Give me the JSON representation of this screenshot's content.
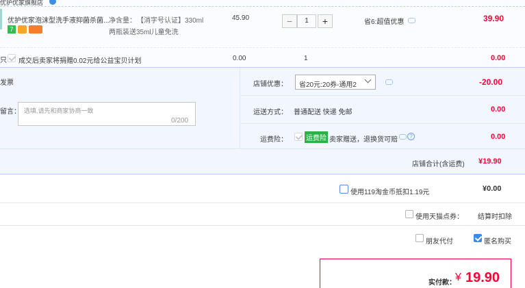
{
  "top": {
    "shop_name_fragment": "优护优家旗舰店"
  },
  "item": {
    "title": "优护优家泡沫型洗手液抑菌杀菌...",
    "spec_label": "净含量：",
    "spec_value": "【消字号认证】330ml",
    "spec_line2": "两瓶装送35ml儿童免洗",
    "unit_price": "45.90",
    "quantity": "1",
    "qty_minus": "−",
    "qty_plus": "+",
    "discount": "省6:超值优惠",
    "subtotal": "39.90",
    "badge_colors": [
      "#2fbf4f",
      "#f5a623",
      "#f57d2c"
    ]
  },
  "charity": {
    "prefix": "只",
    "label": "成交后卖家将捐赠0.02元给公益宝贝计划",
    "price": "0.00",
    "quantity": "1",
    "subtotal": "0.00"
  },
  "left_panel": {
    "invoice_label": "发票",
    "message_label": "留言：",
    "message_placeholder": "选填,请先和商家协商一致",
    "message_counter": "0/200"
  },
  "right_panel": {
    "shop_discount_label": "店铺优惠：",
    "shop_discount_select": "省20元:20券-通用2",
    "shop_discount_value": "-20.00",
    "shipping_label": "运送方式：",
    "shipping_value": "普通配送 快递 免邮",
    "shipping_price": "0.00",
    "insurance_label": "运费险：",
    "insurance_badge": "运费险",
    "insurance_text": "卖家赠送，退换货可赔",
    "insurance_price": "0.00"
  },
  "shop_total": {
    "label": "店铺合计(含运费)",
    "value": "¥19.90"
  },
  "bottom": {
    "taojinbi_label": "使用119淘金币抵扣1.19元",
    "taojinbi_value": "¥0.00",
    "tmall_points_label": "使用天猫点券：",
    "tmall_points_value": "结算时扣除",
    "friend_pay_label": "朋友代付",
    "anonymous_label": "匿名购买"
  },
  "payment": {
    "label": "实付款：",
    "currency": "¥",
    "amount": "19.90"
  },
  "colors": {
    "accent_red": "#ff0036",
    "panel_bg": "#f2f7ff",
    "border_blue": "#b2d1ff"
  }
}
